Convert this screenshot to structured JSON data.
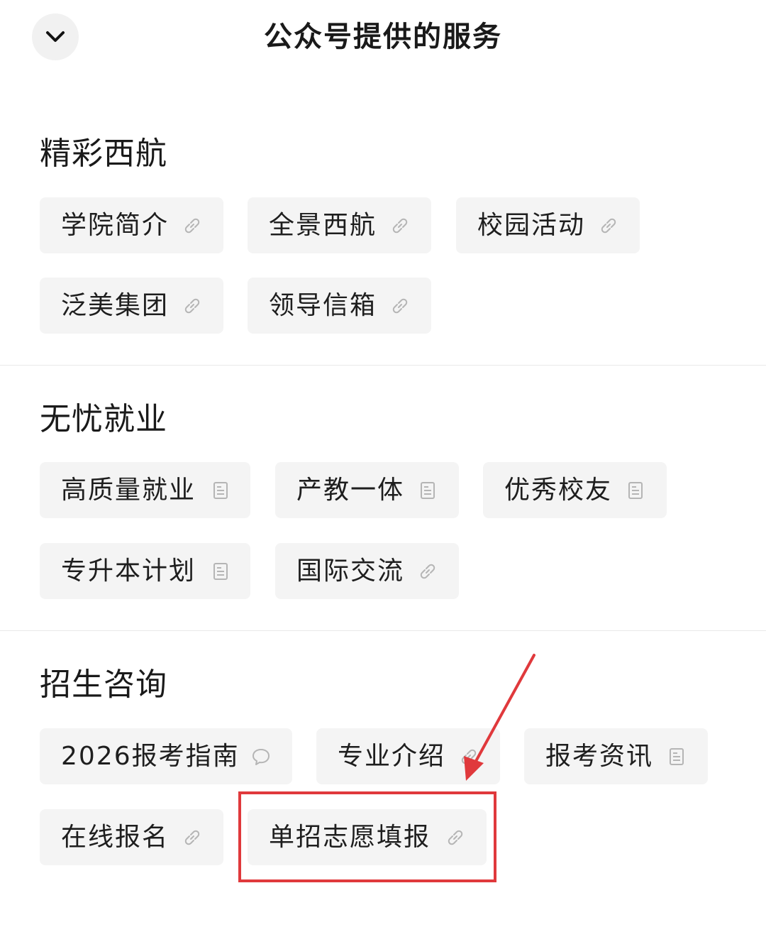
{
  "header": {
    "title": "公众号提供的服务",
    "collapse_icon": "chevron-down-icon"
  },
  "sections": [
    {
      "title": "精彩西航",
      "items": [
        {
          "label": "学院简介",
          "icon": "link-icon"
        },
        {
          "label": "全景西航",
          "icon": "link-icon"
        },
        {
          "label": "校园活动",
          "icon": "link-icon"
        },
        {
          "label": "泛美集团",
          "icon": "link-icon"
        },
        {
          "label": "领导信箱",
          "icon": "link-icon"
        }
      ]
    },
    {
      "title": "无忧就业",
      "items": [
        {
          "label": "高质量就业",
          "icon": "article-icon"
        },
        {
          "label": "产教一体",
          "icon": "article-icon"
        },
        {
          "label": "优秀校友",
          "icon": "article-icon"
        },
        {
          "label": "专升本计划",
          "icon": "article-icon"
        },
        {
          "label": "国际交流",
          "icon": "link-icon"
        }
      ]
    },
    {
      "title": "招生咨询",
      "items": [
        {
          "label": "2026报考指南",
          "icon": "message-icon"
        },
        {
          "label": "专业介绍",
          "icon": "link-icon"
        },
        {
          "label": "报考资讯",
          "icon": "article-icon"
        },
        {
          "label": "在线报名",
          "icon": "link-icon"
        },
        {
          "label": "单招志愿填报",
          "icon": "link-icon"
        }
      ]
    }
  ],
  "annotation": {
    "color": "#e0393c",
    "target": "单招志愿填报"
  }
}
